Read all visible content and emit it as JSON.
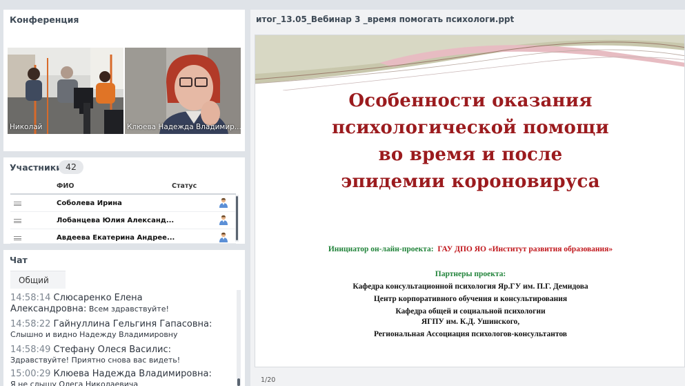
{
  "conference": {
    "title": "Конференция",
    "videos": [
      {
        "name": "Николай"
      },
      {
        "name": "Клюева Надежда  Владимир..."
      }
    ]
  },
  "participants": {
    "title": "Участники",
    "count": "42",
    "columns": {
      "name": "ФИО",
      "status": "Статус"
    },
    "rows": [
      {
        "name": "Соболева Ирина"
      },
      {
        "name": "Лобанцева  Юлия  Александ..."
      },
      {
        "name": "Авдеева Екатерина  Андрее..."
      }
    ]
  },
  "chat": {
    "title": "Чат",
    "tab": "Общий",
    "messages": [
      {
        "time": "14:58:14",
        "author": "Слюсаренко Елена",
        "author_cont": "Александровна:",
        "text": "Всем здравствуйте!"
      },
      {
        "time": "14:58:22",
        "author": "Гайнуллина Гельгиня  Гапасовна:",
        "author_cont": "",
        "text": "Слышно  и видно Надежду Владимировну"
      },
      {
        "time": "14:58:49",
        "author": "Стефану Олеся  Василис:",
        "author_cont": "",
        "text": "Здравствуйте! Приятно снова вас видеть!"
      },
      {
        "time": "15:00:29",
        "author": "Клюева Надежда  Владимировна:",
        "author_cont": "",
        "text": "Я не слышу Олега Николаевича"
      }
    ]
  },
  "presentation": {
    "filename": "итог_13.05_Вебинар 3 _время помогать психологи.ppt",
    "page": "1/20",
    "slide": {
      "title_lines": [
        "Особенности оказания",
        "психологической помощи",
        "во время и после",
        "эпидемии короновируса"
      ],
      "initiator_label": "Инициатор  он-лайн-проекта:",
      "initiator_value": "ГАУ ДПО ЯО «Институт  развития образования»",
      "partners_label": "Партнеры  проекта:",
      "partners": [
        "Кафедра консультационной психология Яр.ГУ им. П.Г. Демидова",
        "Центр корпоративного обучения и консультирования",
        "Кафедра общей и социальной психологии",
        "ЯГПУ  им. К.Д. Ушинского,",
        "Региональная  Ассоциация психологов-консультантов"
      ]
    }
  },
  "colors": {
    "slide_title": "#9b1b1e",
    "green": "#21833a",
    "red": "#c0161b",
    "panel_bg": "#ffffff",
    "app_bg": "#dfe3e8"
  }
}
